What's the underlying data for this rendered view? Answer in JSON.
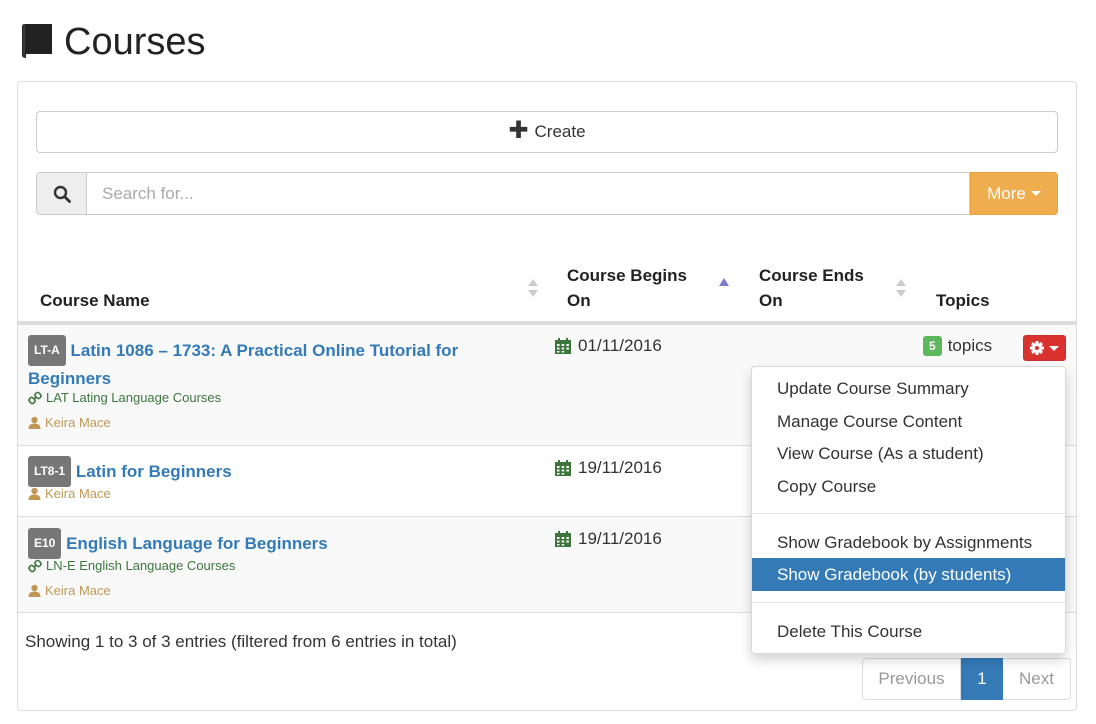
{
  "page": {
    "title": "Courses"
  },
  "toolbar": {
    "create_label": "Create",
    "more_label": "More"
  },
  "search": {
    "placeholder": "Search for...",
    "value": ""
  },
  "table": {
    "headers": {
      "course_name": "Course Name",
      "begins_line1": "Course Begins",
      "begins_line2": "On",
      "ends_line1": "Course Ends",
      "ends_line2": "On",
      "topics": "Topics"
    },
    "rows": [
      {
        "code": "LT-A",
        "name_line1": "Latin 1086 – 1733: A Practical Online Tutorial for",
        "name_line2": "Beginners",
        "category": "LAT Lating Language Courses",
        "teacher": "Keira Mace",
        "begins": "01/11/2016",
        "topics_count": "5",
        "topics_label": "topics"
      },
      {
        "code": "LT8-1",
        "name": "Latin for Beginners",
        "teacher": "Keira Mace",
        "begins": "19/11/2016"
      },
      {
        "code": "E10",
        "name": "English Language for Beginners",
        "category": "LN-E English Language Courses",
        "teacher": "Keira Mace",
        "begins": "19/11/2016"
      }
    ]
  },
  "dropdown": {
    "items": [
      "Update Course Summary",
      "Manage Course Content",
      "View Course (As a student)",
      "Copy Course",
      "Show Gradebook by Assignments",
      "Show Gradebook (by students)",
      "Delete This Course"
    ],
    "active_item": "Show Gradebook (by students)"
  },
  "footer": {
    "info": "Showing 1 to 3 of 3 entries (filtered from 6 entries in total)",
    "prev_label": "Previous",
    "current_page": "1",
    "next_label": "Next"
  },
  "colors": {
    "primary": "#337ab7",
    "warning": "#f0ad4e",
    "danger": "#d9322e",
    "success": "#5cb85c",
    "category_green": "#3c763d",
    "teacher_gold": "#c09853"
  },
  "icons": [
    "book-icon",
    "plus-icon",
    "search-icon",
    "sort-icon",
    "calendar-icon",
    "link-icon",
    "user-icon",
    "gear-icon"
  ]
}
